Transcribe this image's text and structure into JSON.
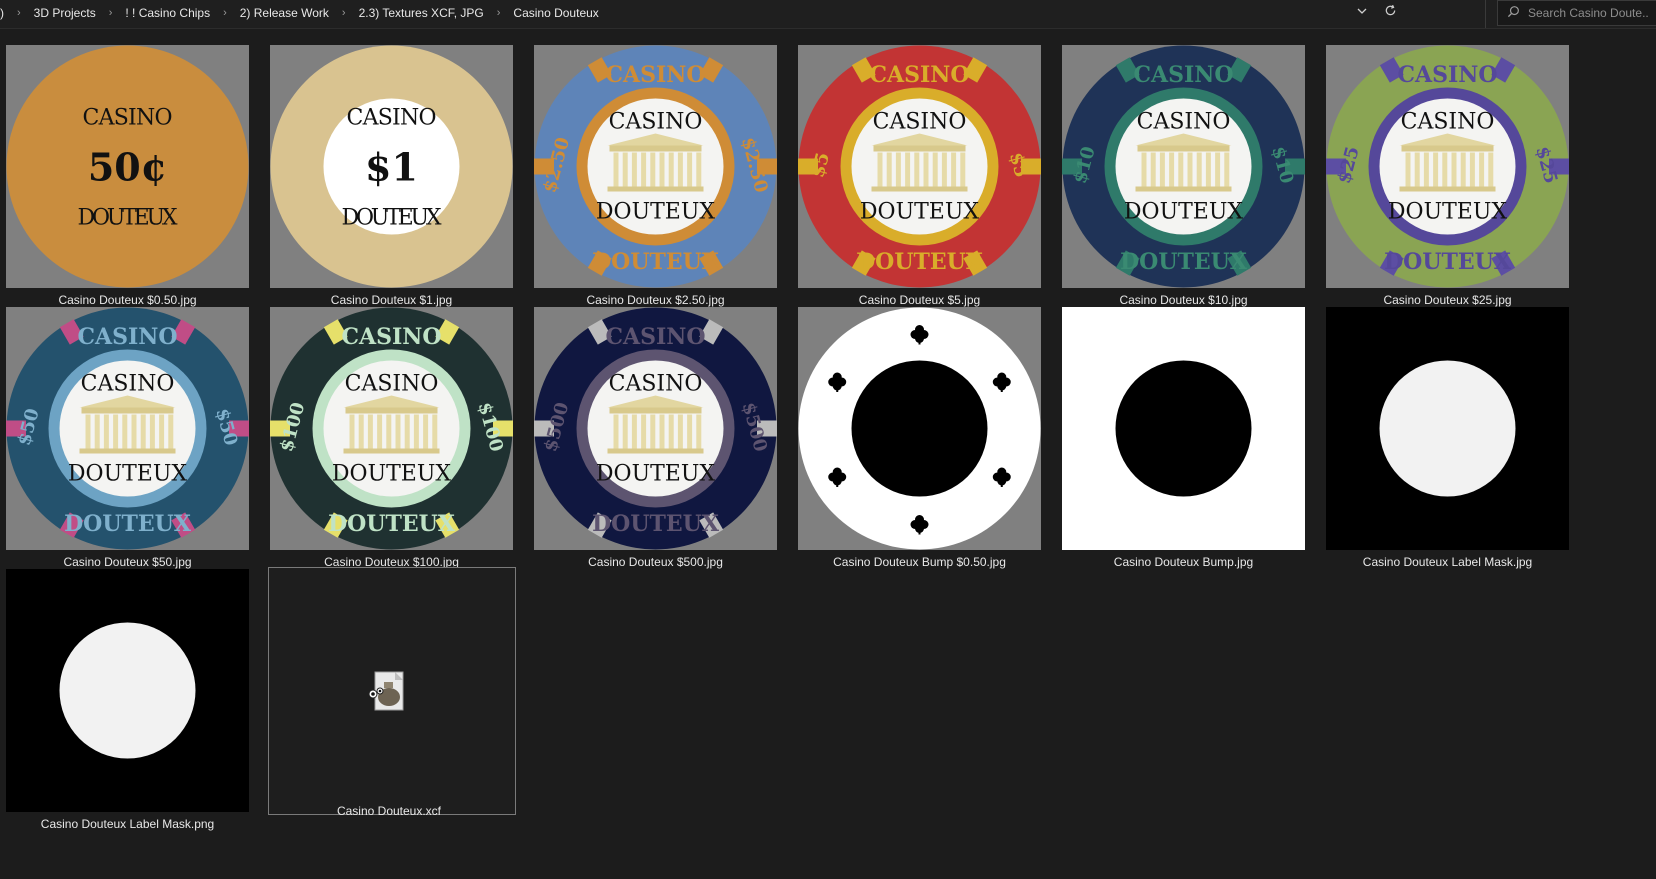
{
  "breadcrumb": {
    "items": [
      ")",
      "3D Projects",
      "! ! Casino Chips",
      "2) Release Work",
      "2.3) Textures XCF, JPG",
      "Casino Douteux"
    ],
    "separator": "›"
  },
  "toolbar": {
    "dropdown_icon": "chevron-down-icon",
    "refresh_icon": "refresh-icon"
  },
  "search": {
    "placeholder": "Search Casino Doute..."
  },
  "chip_text": {
    "casino": "CASINO",
    "douteux": "DOUTEUX"
  },
  "files": [
    {
      "name": "Casino Douteux $0.50.jpg",
      "kind": "chip-plain",
      "value": "50¢",
      "base": "#c98d3e"
    },
    {
      "name": "Casino Douteux $1.jpg",
      "kind": "chip-plain",
      "value": "$1",
      "base": "#d9c390"
    },
    {
      "name": "Casino Douteux $2.50.jpg",
      "kind": "chip",
      "value": "$2.50",
      "base": "#5e84b8",
      "ring": "#cf8c36",
      "stripe": "#cf8c36",
      "text": "#cf8c36"
    },
    {
      "name": "Casino Douteux $5.jpg",
      "kind": "chip",
      "value": "$5",
      "base": "#c23434",
      "ring": "#d9ad2a",
      "stripe": "#d9ad2a",
      "text": "#d9ad2a"
    },
    {
      "name": "Casino Douteux $10.jpg",
      "kind": "chip",
      "value": "$10",
      "base": "#1f3357",
      "ring": "#2f7a6a",
      "stripe": "#2f7a6a",
      "text": "#3a8a72"
    },
    {
      "name": "Casino Douteux $25.jpg",
      "kind": "chip",
      "value": "$25",
      "base": "#8aa453",
      "ring": "#55489a",
      "stripe": "#5c4ea3",
      "text": "#55489a"
    },
    {
      "name": "Casino Douteux $50.jpg",
      "kind": "chip",
      "value": "$50",
      "base": "#24526d",
      "ring": "#6da3c4",
      "stripe": "#c04d86",
      "text": "#7fb0cc"
    },
    {
      "name": "Casino Douteux $100.jpg",
      "kind": "chip",
      "value": "$100",
      "base": "#1f3131",
      "ring": "#bfe2c6",
      "stripe": "#e6e06a",
      "text": "#bfe2c6"
    },
    {
      "name": "Casino Douteux $500.jpg",
      "kind": "chip",
      "value": "$500",
      "base": "#101740",
      "ring": "#5d5470",
      "stripe": "#bbbbbb",
      "text": "#5d5470"
    },
    {
      "name": "Casino Douteux Bump $0.50.jpg",
      "kind": "bump-clover"
    },
    {
      "name": "Casino Douteux Bump.jpg",
      "kind": "bump"
    },
    {
      "name": "Casino Douteux Label Mask.jpg",
      "kind": "mask"
    },
    {
      "name": "Casino Douteux Label Mask.png",
      "kind": "mask"
    },
    {
      "name": "Casino Douteux.xcf",
      "kind": "xcf",
      "icon": "gimp-file-icon",
      "selected": true
    }
  ]
}
